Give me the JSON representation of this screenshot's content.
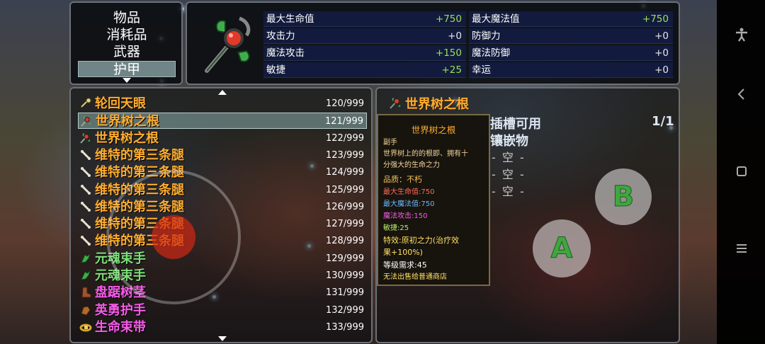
{
  "categories": {
    "items": [
      "物品",
      "消耗品",
      "武器",
      "护甲"
    ],
    "active_index": 3
  },
  "equipped": {
    "icon": "staff-icon",
    "stats_left": [
      {
        "label": "最大生命值",
        "value": "+750"
      },
      {
        "label": "攻击力",
        "value": "+0"
      },
      {
        "label": "魔法攻击",
        "value": "+150"
      },
      {
        "label": "敏捷",
        "value": "+25"
      }
    ],
    "stats_right": [
      {
        "label": "最大魔法值",
        "value": "+750"
      },
      {
        "label": "防御力",
        "value": "+0"
      },
      {
        "label": "魔法防御",
        "value": "+0"
      },
      {
        "label": "幸运",
        "value": "+0"
      }
    ]
  },
  "items": [
    {
      "name": "轮回天眼",
      "count": "120/999",
      "color": "#ffad2e",
      "icon": "eye-icon"
    },
    {
      "name": "世界树之根",
      "count": "121/999",
      "color": "#ffad2e",
      "icon": "staff-icon"
    },
    {
      "name": "世界树之根",
      "count": "122/999",
      "color": "#ffad2e",
      "icon": "staff-icon"
    },
    {
      "name": "维特的第三条腿",
      "count": "123/999",
      "color": "#ffad2e",
      "icon": "bone-icon"
    },
    {
      "name": "维特的第三条腿",
      "count": "124/999",
      "color": "#ffad2e",
      "icon": "bone-icon"
    },
    {
      "name": "维特的第三条腿",
      "count": "125/999",
      "color": "#ffad2e",
      "icon": "bone-icon"
    },
    {
      "name": "维特的第三条腿",
      "count": "126/999",
      "color": "#ffad2e",
      "icon": "bone-icon"
    },
    {
      "name": "维特的第三条腿",
      "count": "127/999",
      "color": "#ffad2e",
      "icon": "bone-icon"
    },
    {
      "name": "维特的第三条腿",
      "count": "128/999",
      "color": "#ffad2e",
      "icon": "bone-icon"
    },
    {
      "name": "元魂束手",
      "count": "129/999",
      "color": "#7de07a",
      "icon": "green-glove-icon"
    },
    {
      "name": "元魂束手",
      "count": "130/999",
      "color": "#7de07a",
      "icon": "green-glove-icon"
    },
    {
      "name": "盘踞树茎",
      "count": "131/999",
      "color": "#f55ce8",
      "icon": "boot-icon"
    },
    {
      "name": "英勇护手",
      "count": "132/999",
      "color": "#f55ce8",
      "icon": "gauntlet-icon"
    },
    {
      "name": "生命束带",
      "count": "133/999",
      "color": "#f55ce8",
      "icon": "belt-icon"
    }
  ],
  "selected_index": 1,
  "detail": {
    "title": "世界树之根",
    "slot_label": "插槽可用",
    "slot_count": "1/1",
    "gem_label": "镶嵌物",
    "empty_slots": [
      "- 空 -",
      "- 空 -",
      "- 空 -"
    ]
  },
  "tooltip": {
    "title": "世界树之根",
    "type": "副手",
    "desc_1": "世界树上的的根即、拥有十",
    "desc_2": "分强大的生命之力",
    "quality": "品质：不朽",
    "stat_hp": "最大生命值:750",
    "stat_mp": "最大魔法值:750",
    "stat_matk": "魔法攻击:150",
    "stat_agi": "敏捷:25",
    "effect_1": "特效:原初之力(治疗效",
    "effect_2": "果+100%)",
    "level_req": "等级需求:45",
    "sell_note": "无法出售给普通商店"
  },
  "controls": {
    "a_label": "A",
    "b_label": "B"
  },
  "colors": {
    "orange": "#ffad2e",
    "green": "#7de07a",
    "magenta": "#f55ce8",
    "stat_green": "#9be05a"
  },
  "system_bar": {
    "icons": [
      "accessibility-icon",
      "back-icon",
      "home-icon",
      "recents-icon"
    ]
  }
}
